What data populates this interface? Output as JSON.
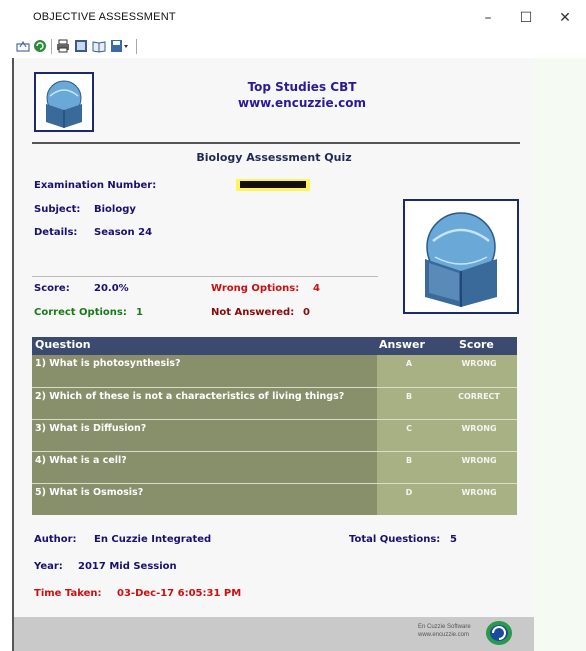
{
  "window": {
    "title": "OBJECTIVE ASSESSMENT",
    "minimize": "–",
    "maximize": "☐",
    "close": "✕"
  },
  "toolbar": {
    "icons": [
      "export-icon",
      "refresh-icon",
      "print-icon",
      "page-setup-icon",
      "book-view-icon",
      "save-dropdown-icon"
    ]
  },
  "report": {
    "org_name": "Top Studies CBT",
    "org_url": "www.encuzzie.com",
    "quiz_title": "Biology Assessment Quiz",
    "exam_number_label": "Examination Number:",
    "subject_label": "Subject:",
    "subject_value": "Biology",
    "details_label": "Details:",
    "details_value": "Season 24",
    "score_label": "Score:",
    "score_value": "20.0%",
    "wrong_label": "Wrong Options:",
    "wrong_value": "4",
    "correct_label": "Correct Options:",
    "correct_value": "1",
    "unanswered_label": "Not Answered:",
    "unanswered_value": "0",
    "table": {
      "headers": {
        "question": "Question",
        "answer": "Answer",
        "score": "Score"
      },
      "rows": [
        {
          "question": "1) What is photosynthesis?",
          "answer": "A",
          "score": "WRONG"
        },
        {
          "question": "2) Which of these is not a characteristics of living things?",
          "answer": "B",
          "score": "CORRECT"
        },
        {
          "question": "3) What is Diffusion?",
          "answer": "C",
          "score": "WRONG"
        },
        {
          "question": "4) What is a cell?",
          "answer": "B",
          "score": "WRONG"
        },
        {
          "question": "5) What is Osmosis?",
          "answer": "D",
          "score": "WRONG"
        }
      ]
    },
    "author_label": "Author:",
    "author_value": "En Cuzzie Integrated",
    "total_label": "Total Questions:",
    "total_value": "5",
    "year_label": "Year:",
    "year_value": "2017 Mid Session",
    "time_label": "Time Taken:",
    "time_value": "03-Dec-17 6:05:31 PM",
    "footer_company": "En Cuzzie Software",
    "footer_url": "www.encuzzie.com"
  },
  "colors": {
    "header_band": "#3b4a6e",
    "question_cell": "#87906a",
    "answer_cell": "#a8b183",
    "wrong_text": "#cc1010",
    "correct_text": "#1a7a1a",
    "label_text": "#1a1070"
  }
}
